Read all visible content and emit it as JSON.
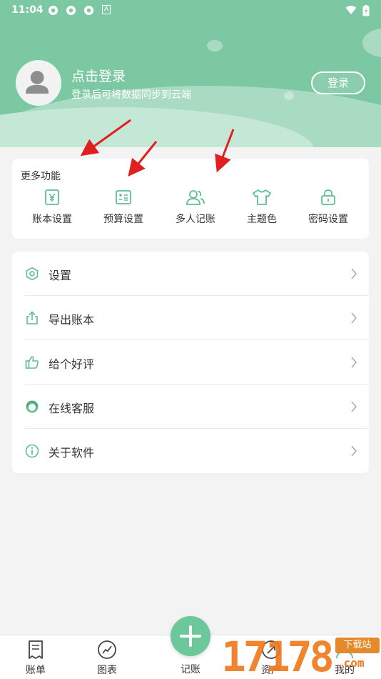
{
  "status_bar": {
    "time": "11:04",
    "extra_icon": "A"
  },
  "profile": {
    "title": "点击登录",
    "subtitle": "登录后可将数据同步到云端",
    "login_button": "登录"
  },
  "more_functions": {
    "title": "更多功能",
    "items": [
      {
        "label": "账本设置",
        "icon": "yen-book-icon"
      },
      {
        "label": "预算设置",
        "icon": "budget-icon"
      },
      {
        "label": "多人记账",
        "icon": "users-icon"
      },
      {
        "label": "主题色",
        "icon": "tshirt-icon"
      },
      {
        "label": "密码设置",
        "icon": "lock-icon"
      }
    ]
  },
  "menu": {
    "items": [
      {
        "label": "设置",
        "icon": "settings-hex-icon"
      },
      {
        "label": "导出账本",
        "icon": "export-icon"
      },
      {
        "label": "给个好评",
        "icon": "thumbs-up-icon"
      },
      {
        "label": "在线客服",
        "icon": "headset-icon"
      },
      {
        "label": "关于软件",
        "icon": "info-icon"
      }
    ]
  },
  "bottom_nav": {
    "tabs": [
      {
        "label": "账单",
        "icon": "bill-icon"
      },
      {
        "label": "图表",
        "icon": "chart-icon"
      },
      {
        "label": "记账",
        "icon": "plus-icon"
      },
      {
        "label": "资产",
        "icon": "assets-icon"
      },
      {
        "label": "我的",
        "icon": "profile-icon"
      }
    ]
  },
  "watermark": {
    "number": "17178",
    "badge": "下载站",
    "domain": ".com"
  },
  "colors": {
    "primary": "#7cc8a3",
    "accent_icon": "#5fbf90",
    "arrow": "#e02020"
  }
}
